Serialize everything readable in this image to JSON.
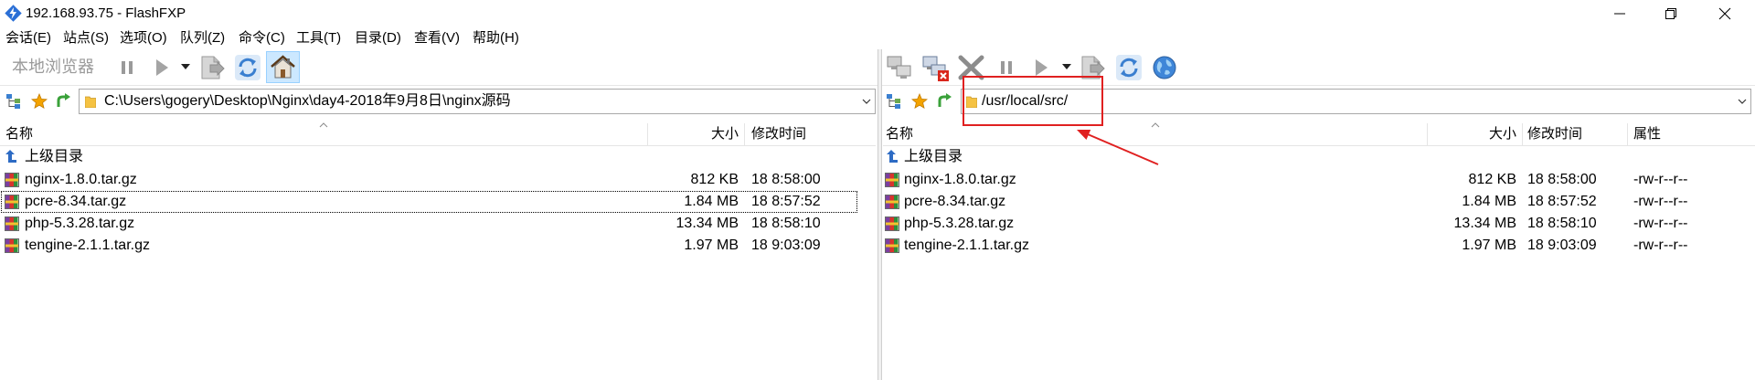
{
  "window": {
    "title": "192.168.93.75 - FlashFXP",
    "controls": [
      "minimize-icon",
      "restore-icon",
      "close-icon"
    ]
  },
  "menu": [
    "会话(E)",
    "站点(S)",
    "选项(O)",
    "队列(Z)",
    "命令(C)",
    "工具(T)",
    "目录(D)",
    "查看(V)",
    "帮助(H)"
  ],
  "local": {
    "toolbar_label": "本地浏览器",
    "toolbar_icons": [
      "pause-icon",
      "play-icon",
      "dropdown-arrow-icon",
      "transfer-queue-icon",
      "refresh-icon",
      "home-icon"
    ],
    "path": "C:\\Users\\gogery\\Desktop\\Nginx\\day4-2018年9月8日\\nginx源码",
    "columns": {
      "name": "名称",
      "size": "大小",
      "modified": "修改时间"
    },
    "parent_label": "上级目录",
    "files": [
      {
        "name": "nginx-1.8.0.tar.gz",
        "size": "812 KB",
        "modified": "18 8:58:00",
        "selected": false
      },
      {
        "name": "pcre-8.34.tar.gz",
        "size": "1.84 MB",
        "modified": "18 8:57:52",
        "selected": true
      },
      {
        "name": "php-5.3.28.tar.gz",
        "size": "13.34 MB",
        "modified": "18 8:58:10",
        "selected": false
      },
      {
        "name": "tengine-2.1.1.tar.gz",
        "size": "1.97 MB",
        "modified": "18 9:03:09",
        "selected": false
      }
    ]
  },
  "remote": {
    "toolbar_icons": [
      "connect-icon",
      "disconnect-icon",
      "abort-icon",
      "pause-icon",
      "play-icon",
      "dropdown-arrow-icon",
      "transfer-queue-icon",
      "refresh-icon",
      "globe-icon"
    ],
    "path": "/usr/local/src/",
    "columns": {
      "name": "名称",
      "size": "大小",
      "modified": "修改时间",
      "attributes": "属性"
    },
    "parent_label": "上级目录",
    "files": [
      {
        "name": "nginx-1.8.0.tar.gz",
        "size": "812 KB",
        "modified": "18 8:58:00",
        "attributes": "-rw-r--r--"
      },
      {
        "name": "pcre-8.34.tar.gz",
        "size": "1.84 MB",
        "modified": "18 8:57:52",
        "attributes": "-rw-r--r--"
      },
      {
        "name": "php-5.3.28.tar.gz",
        "size": "13.34 MB",
        "modified": "18 8:58:10",
        "attributes": "-rw-r--r--"
      },
      {
        "name": "tengine-2.1.1.tar.gz",
        "size": "1.97 MB",
        "modified": "18 9:03:09",
        "attributes": "-rw-r--r--"
      }
    ]
  },
  "colors": {
    "annotation": "#e02020",
    "home_button_highlight": "#cce8ff",
    "folder": "#f5c242",
    "favorites_star": "#f4a300",
    "refresh": "#3a7fd0"
  }
}
